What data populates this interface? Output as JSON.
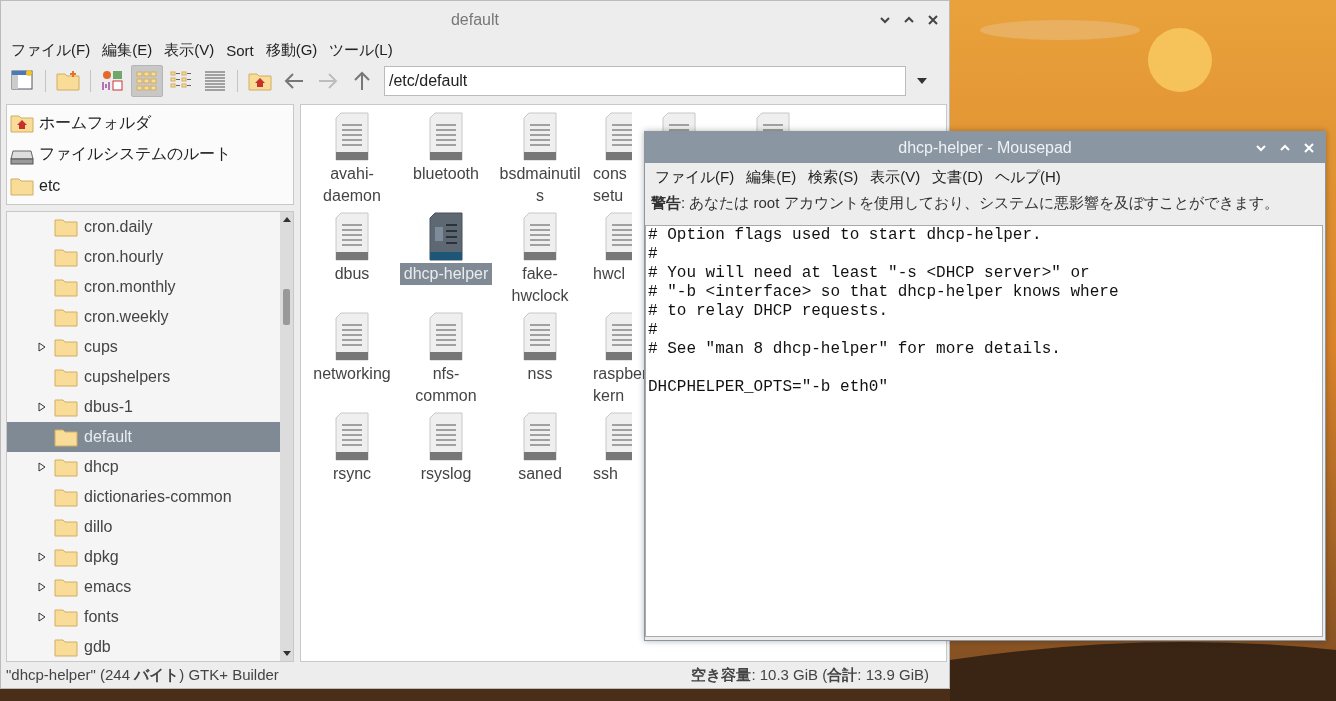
{
  "file_manager": {
    "title": "default",
    "menu": [
      "ファイル(F)",
      "編集(E)",
      "表示(V)",
      "Sort",
      "移動(G)",
      "ツール(L)"
    ],
    "toolbar": [
      {
        "kind": "new-window",
        "selected": false,
        "disabled": false
      },
      {
        "kind": "new-folder",
        "selected": false,
        "disabled": false
      },
      {
        "kind": "thumbnail-view",
        "selected": false,
        "disabled": false
      },
      {
        "kind": "icon-view",
        "selected": true,
        "disabled": false
      },
      {
        "kind": "compact-view",
        "selected": false,
        "disabled": false
      },
      {
        "kind": "list-view",
        "selected": false,
        "disabled": false
      },
      {
        "kind": "home",
        "selected": false,
        "disabled": false
      },
      {
        "kind": "back",
        "selected": false,
        "disabled": false
      },
      {
        "kind": "forward",
        "selected": false,
        "disabled": true
      },
      {
        "kind": "up",
        "selected": false,
        "disabled": false
      }
    ],
    "path": "/etc/default",
    "places": [
      {
        "kind": "home",
        "label": "ホームフォルダ"
      },
      {
        "kind": "drive",
        "label": "ファイルシステムのルート"
      },
      {
        "kind": "folder",
        "label": "etc"
      }
    ],
    "tree": [
      {
        "label": "cron.daily",
        "expandable": false,
        "selected": false
      },
      {
        "label": "cron.hourly",
        "expandable": false,
        "selected": false
      },
      {
        "label": "cron.monthly",
        "expandable": false,
        "selected": false
      },
      {
        "label": "cron.weekly",
        "expandable": false,
        "selected": false
      },
      {
        "label": "cups",
        "expandable": true,
        "selected": false
      },
      {
        "label": "cupshelpers",
        "expandable": false,
        "selected": false
      },
      {
        "label": "dbus-1",
        "expandable": true,
        "selected": false
      },
      {
        "label": "default",
        "expandable": false,
        "selected": true
      },
      {
        "label": "dhcp",
        "expandable": true,
        "selected": false
      },
      {
        "label": "dictionaries-common",
        "expandable": false,
        "selected": false
      },
      {
        "label": "dillo",
        "expandable": false,
        "selected": false
      },
      {
        "label": "dpkg",
        "expandable": true,
        "selected": false
      },
      {
        "label": "emacs",
        "expandable": true,
        "selected": false
      },
      {
        "label": "fonts",
        "expandable": true,
        "selected": false
      },
      {
        "label": "gdb",
        "expandable": false,
        "selected": false
      }
    ],
    "file_rows": [
      [
        {
          "lines": [
            "avahi-",
            "daemon"
          ],
          "selected": false
        },
        {
          "lines": [
            "bluetooth"
          ],
          "selected": false
        },
        {
          "lines": [
            "bsdmainutil",
            "s"
          ],
          "selected": false
        },
        {
          "lines": [
            "cons",
            "setu"
          ],
          "selected": false
        },
        {
          "selected": false
        },
        {
          "selected": false
        }
      ],
      [
        {
          "lines": [
            "dbus"
          ],
          "selected": false
        },
        {
          "lines": [
            "dhcp-helper"
          ],
          "selected": true
        },
        {
          "lines": [
            "fake-",
            "hwclock"
          ],
          "selected": false
        },
        {
          "lines": [
            "hwcl"
          ],
          "selected": false
        }
      ],
      [
        {
          "lines": [
            "networking"
          ],
          "selected": false
        },
        {
          "lines": [
            "nfs-",
            "common"
          ],
          "selected": false
        },
        {
          "lines": [
            "nss"
          ],
          "selected": false
        },
        {
          "lines": [
            "raspber",
            "kern"
          ],
          "selected": false
        }
      ],
      [
        {
          "lines": [
            "rsync"
          ],
          "selected": false
        },
        {
          "lines": [
            "rsyslog"
          ],
          "selected": false
        },
        {
          "lines": [
            "saned"
          ],
          "selected": false
        },
        {
          "lines": [
            "ssh"
          ],
          "selected": false
        }
      ]
    ],
    "status_left": "\"dhcp-helper\" (244 **バイト**) GTK+ Builder",
    "status_right": "**空き容量**: 10.3 GiB (**合計**: 13.9 GiB)"
  },
  "editor": {
    "title": "dhcp-helper - Mousepad",
    "menu": [
      "ファイル(F)",
      "編集(E)",
      "検索(S)",
      "表示(V)",
      "文書(D)",
      "ヘルプ(H)"
    ],
    "warning": "**警告**: あなたは root アカウントを使用しており、システムに悪影響を及ぼすことができます。",
    "content": "# Option flags used to start dhcp-helper.\n#\n# You will need at least \"-s <DHCP server>\" or\n# \"-b <interface> so that dhcp-helper knows where\n# to relay DHCP requests.\n#\n# See \"man 8 dhcp-helper\" for more details.\n\nDHCPHELPER_OPTS=\"-b eth0\""
  }
}
